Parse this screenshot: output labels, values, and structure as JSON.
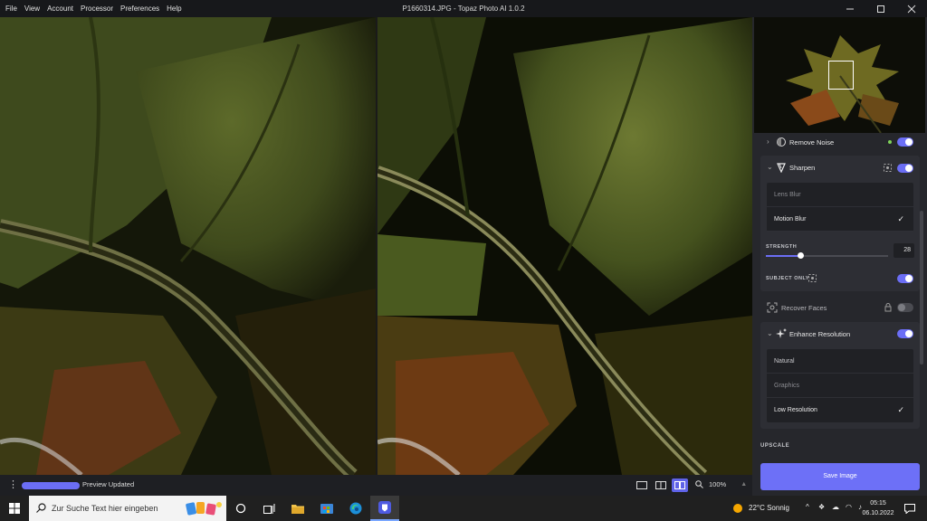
{
  "window": {
    "title": "P1660314.JPG - Topaz Photo AI 1.0.2",
    "menu": [
      "File",
      "View",
      "Account",
      "Processor",
      "Preferences",
      "Help"
    ]
  },
  "status": {
    "text": "Preview Updated",
    "progress_fraction": 1.0,
    "zoom": "100%"
  },
  "panel": {
    "remove_noise": {
      "label": "Remove Noise",
      "enabled": true
    },
    "sharpen": {
      "label": "Sharpen",
      "enabled": true,
      "options": [
        "Lens Blur",
        "Motion Blur"
      ],
      "selected": "Motion Blur",
      "strength_label": "STRENGTH",
      "strength_value": "28",
      "strength_fraction": 0.28,
      "subject_only_label": "SUBJECT ONLY",
      "subject_only": true
    },
    "recover_faces": {
      "label": "Recover Faces",
      "enabled": false
    },
    "enhance_resolution": {
      "label": "Enhance Resolution",
      "enabled": true,
      "options": [
        "Natural",
        "Graphics",
        "Low Resolution"
      ],
      "selected": "Low Resolution"
    },
    "upscale_label": "UPSCALE",
    "save_label": "Save Image"
  },
  "taskbar": {
    "search_placeholder": "Zur Suche Text hier eingeben",
    "weather": "22°C  Sonnig",
    "time": "05:15",
    "date": "06.10.2022"
  },
  "colors": {
    "accent": "#6b6ef5",
    "panel_bg": "#26272c",
    "section_bg": "#2d2e34"
  }
}
